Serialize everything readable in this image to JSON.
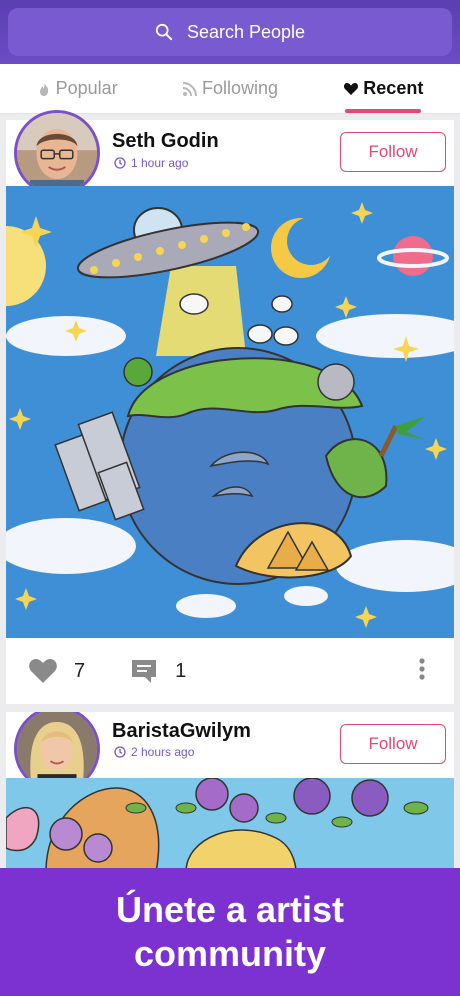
{
  "search": {
    "label": "Search People"
  },
  "tabs": [
    {
      "label": "Popular",
      "icon": "flame-icon"
    },
    {
      "label": "Following",
      "icon": "rss-icon"
    },
    {
      "label": "Recent",
      "icon": "heart-icon",
      "active": true
    }
  ],
  "posts": [
    {
      "author": "Seth Godin",
      "time": "1 hour ago",
      "follow_label": "Follow",
      "likes": "7",
      "comments": "1"
    },
    {
      "author": "BaristaGwilym",
      "time": "2 hours ago",
      "follow_label": "Follow"
    }
  ],
  "banner": {
    "text": "Únete a artist community"
  },
  "colors": {
    "header": "#6d4cc6",
    "accent": "#e14a75",
    "banner": "#7b32d0",
    "avatar_ring": "#7a52c6"
  }
}
